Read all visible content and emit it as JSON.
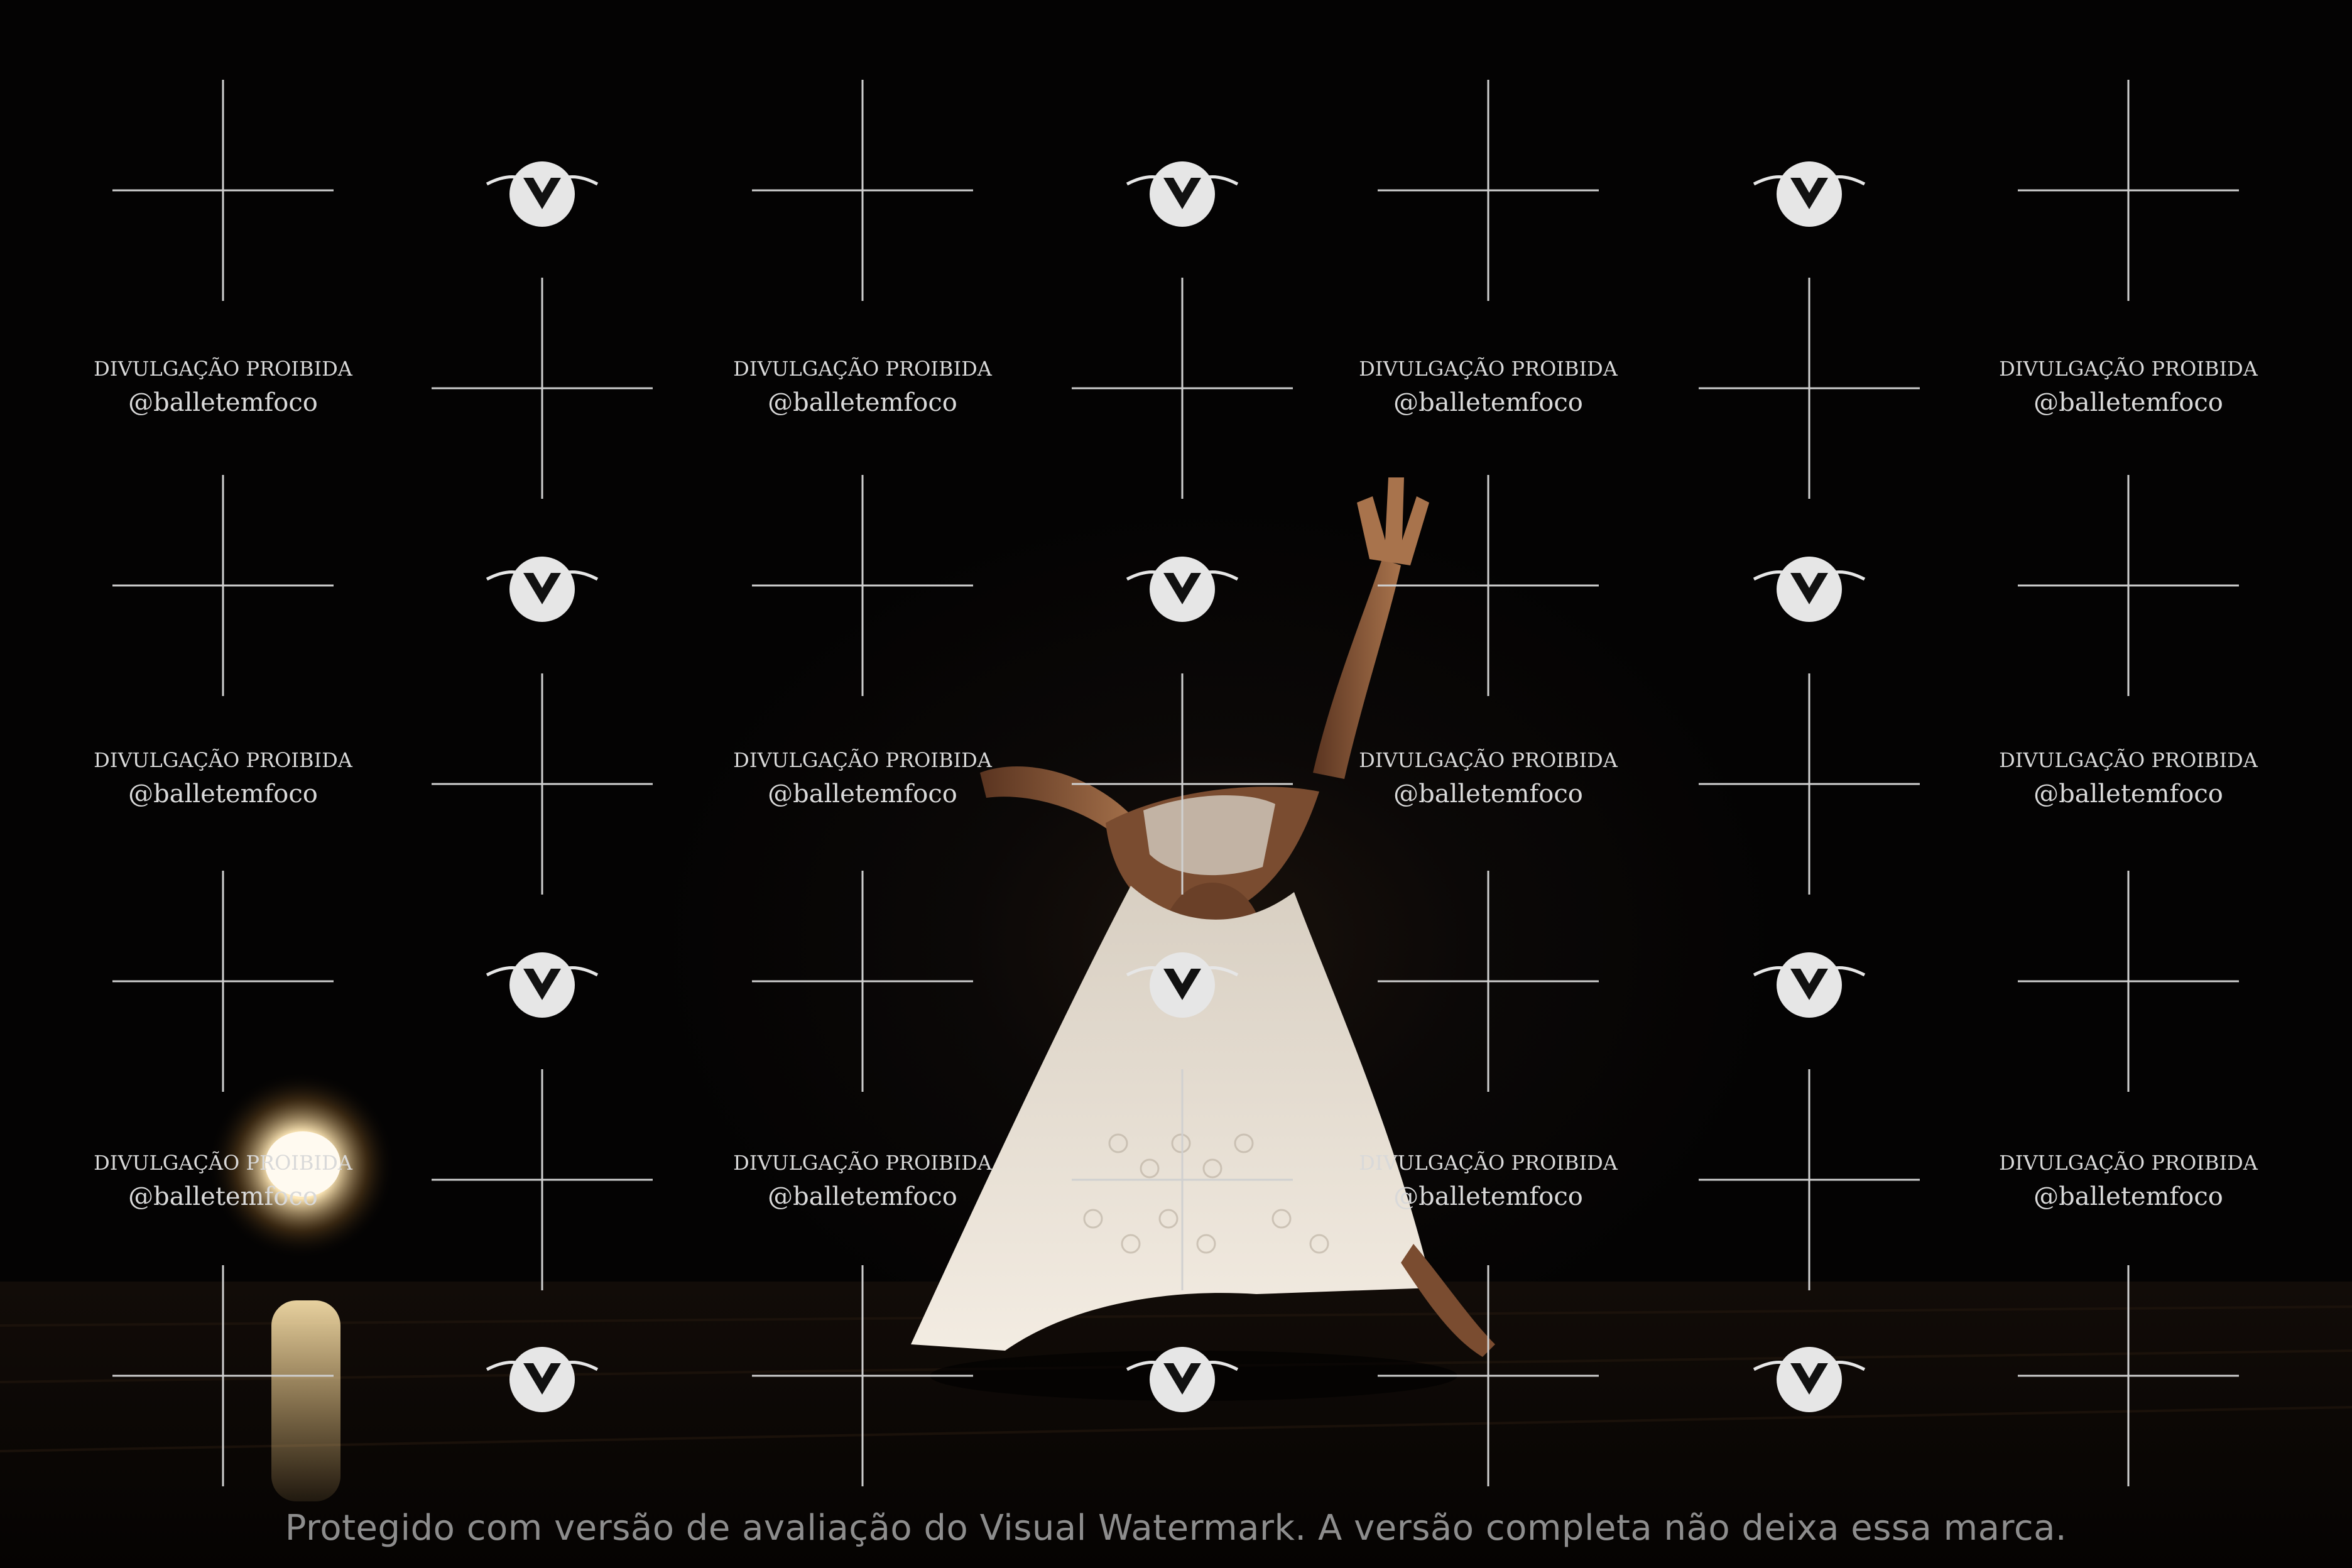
{
  "watermark": {
    "line1": "DIVULGAÇÃO PROIBIDA",
    "line2": "@balletemfoco",
    "logo_icon": "balletemfoco-logo-icon",
    "cross_icon": "crosshair-icon",
    "color": "#d9d9d9"
  },
  "evaluation_notice": "Protegido com versão de avaliação do Visual Watermark. A versão completa não deixa essa marca.",
  "scene": {
    "subject": "dancer in white dress",
    "light": "stage spotlight",
    "colors": {
      "background": "#050404",
      "dress": "#e8e0d4",
      "skin": "#8a5a3a",
      "spotlight": "#fff6e0"
    }
  }
}
